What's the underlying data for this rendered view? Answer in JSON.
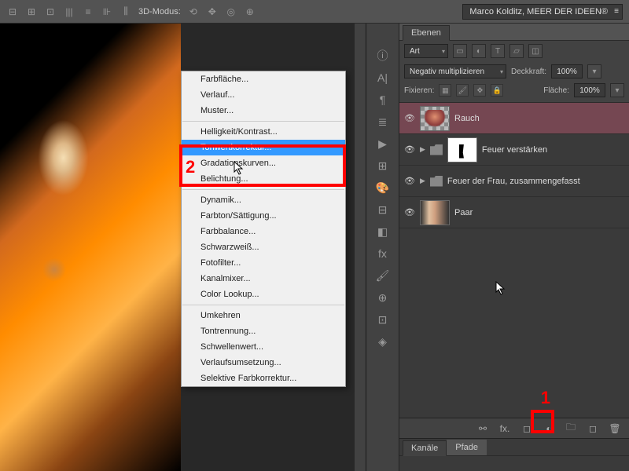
{
  "topbar": {
    "mode3d": "3D-Modus:",
    "workspace": "Marco Kolditz, MEER DER IDEEN®"
  },
  "layers_panel": {
    "tab": "Ebenen",
    "filter": "Art",
    "blend_mode": "Negativ multiplizieren",
    "opacity_label": "Deckkraft:",
    "opacity": "100%",
    "fill_label": "Fläche:",
    "fill": "100%",
    "lock_label": "Fixieren:"
  },
  "layers": [
    {
      "name": "Rauch"
    },
    {
      "name": "Feuer verstärken"
    },
    {
      "name": "Feuer der Frau, zusammengefasst"
    },
    {
      "name": "Paar"
    }
  ],
  "channels_panel": {
    "tab1": "Kanäle",
    "tab2": "Pfade"
  },
  "menu": {
    "items": [
      "Farbfläche...",
      "Verlauf...",
      "Muster...",
      "-",
      "Helligkeit/Kontrast...",
      "Tonwertkorrektur...",
      "Gradationskurven...",
      "Belichtung...",
      "-",
      "Dynamik...",
      "Farbton/Sättigung...",
      "Farbbalance...",
      "Schwarzweiß...",
      "Fotofilter...",
      "Kanalmixer...",
      "Color Lookup...",
      "-",
      "Umkehren",
      "Tontrennung...",
      "Schwellenwert...",
      "Verlaufsumsetzung...",
      "Selektive Farbkorrektur..."
    ]
  },
  "callouts": {
    "n1": "1",
    "n2": "2"
  }
}
